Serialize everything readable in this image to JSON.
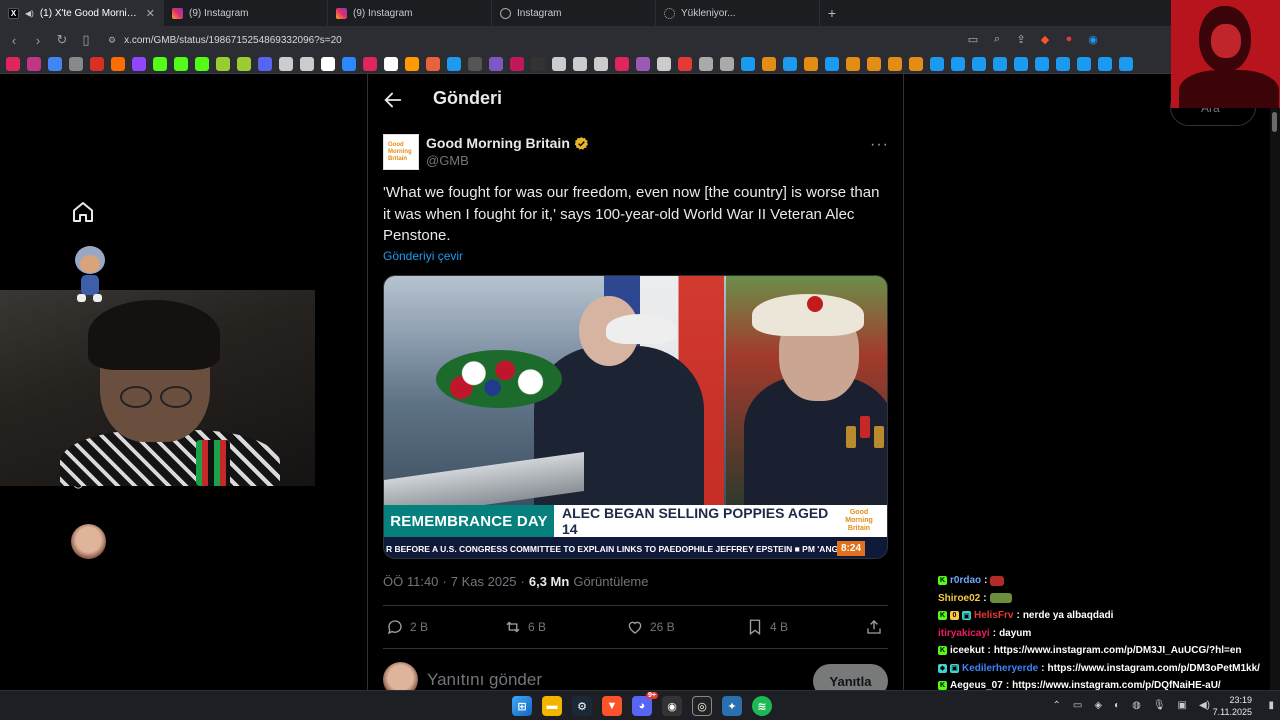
{
  "browser": {
    "tabs": [
      {
        "title": "(1) X'te Good Morning Britain",
        "favicon": "X",
        "active": true,
        "close": "✕"
      },
      {
        "title": "(9) Instagram",
        "favicon": "ig",
        "active": false
      },
      {
        "title": "(9) Instagram",
        "favicon": "ig",
        "active": false
      },
      {
        "title": "Instagram",
        "favicon": "loading",
        "active": false
      },
      {
        "title": "Yükleniyor...",
        "favicon": "loading",
        "active": false
      }
    ],
    "new_tab": "+",
    "url": "x.com/GMB/status/1986715254869332096?s=20",
    "bookmark_colors": [
      "#e0245e",
      "#c13584",
      "#4285f4",
      "#888",
      "#d93025",
      "#ff6d00",
      "#9146ff",
      "#53fc18",
      "#53fc18",
      "#53fc18",
      "#9acd32",
      "#9acd32",
      "#5865f2",
      "#ccc",
      "#ccc",
      "#fff",
      "#2d88ff",
      "#e0245e",
      "#fff",
      "#ff9900",
      "#e8633b",
      "#1d9bf0",
      "#555",
      "#7e57c2",
      "#c2185b",
      "#333",
      "#ccc",
      "#ccc",
      "#ccc",
      "#e0245e",
      "#9b59b6",
      "#ccc",
      "#e53935",
      "#aaa",
      "#aaa",
      "#1b9bf0",
      "#e48d14",
      "#1b9bf0",
      "#e48d14",
      "#1b9bf0",
      "#e48d14",
      "#e48d14",
      "#e48d14",
      "#e48d14",
      "#1b9bf0",
      "#1b9bf0",
      "#1b9bf0",
      "#1b9bf0",
      "#1b9bf0",
      "#1b9bf0",
      "#1b9bf0",
      "#1b9bf0",
      "#1b9bf0",
      "#1b9bf0"
    ]
  },
  "header": {
    "title": "Gönderi"
  },
  "tweet": {
    "display_name": "Good Morning Britain",
    "handle": "@GMB",
    "avatar_text": [
      "Good",
      "Morning",
      "Britain"
    ],
    "text": "'What we fought for was our freedom, even now [the country] is worse than it was when I fought for it,' says 100-year-old World War II Veteran Alec Penstone.",
    "translate_label": "Gönderiyi çevir",
    "more": "···",
    "media": {
      "lower_third_title": "REMEMBRANCE DAY",
      "lower_third_subtitle": "ALEC BEGAN SELLING POPPIES AGED 14",
      "logo_text": [
        "Good",
        "Morning",
        "Britain"
      ],
      "ticker": "R BEFORE A U.S. CONGRESS COMMITTEE TO EXPLAIN LINKS TO PAEDOPHILE JEFFREY EPSTEIN     ■     PM 'ANGE",
      "clock": "8:24"
    },
    "time": "ÖÖ 11:40",
    "date": "7 Kas 2025",
    "views": "6,3 Mn",
    "views_label": "Görüntüleme",
    "sep": "·",
    "replies": "2 B",
    "reposts": "6 B",
    "likes": "26 B",
    "bookmarks": "4 B",
    "reply_placeholder": "Yanıtını gönder",
    "reply_button": "Yanıtla"
  },
  "right": {
    "search_placeholder": "Ara"
  },
  "chat": [
    {
      "user": "r0rdao",
      "color": "#6ea7ff",
      "text": "",
      "badges": [
        "K"
      ],
      "emote": "red"
    },
    {
      "user": "Shiroe02",
      "color": "#f7c948",
      "text": "",
      "badges": [],
      "emote": "green"
    },
    {
      "user": "HelisFrv",
      "color": "#e53935",
      "text": "nerde ya albaqdadi",
      "badges": [
        "K",
        "0",
        "▣"
      ],
      "emote": ""
    },
    {
      "user": "itiryakicayi",
      "color": "#e91e63",
      "text": "dayum",
      "badges": [],
      "emote": ""
    },
    {
      "user": "iceekut",
      "color": "#ffffff",
      "text": "https://www.instagram.com/p/DM3JI_AuUCG/?hl=en",
      "badges": [
        "K"
      ],
      "emote": ""
    },
    {
      "user": "Kedilerheryerde",
      "color": "#3b82f6",
      "text": "https://www.instagram.com/p/DM3oPetM1kk/",
      "badges": [
        "◆",
        "▣"
      ],
      "emote": ""
    },
    {
      "user": "Aegeus_07",
      "color": "#ffffff",
      "text": "https://www.instagram.com/p/DQfNaiHE-aU/",
      "badges": [
        "K"
      ],
      "emote": ""
    }
  ],
  "taskbar": {
    "time": "23:19",
    "date": "7.11.2025",
    "notif_badge": "9+"
  }
}
